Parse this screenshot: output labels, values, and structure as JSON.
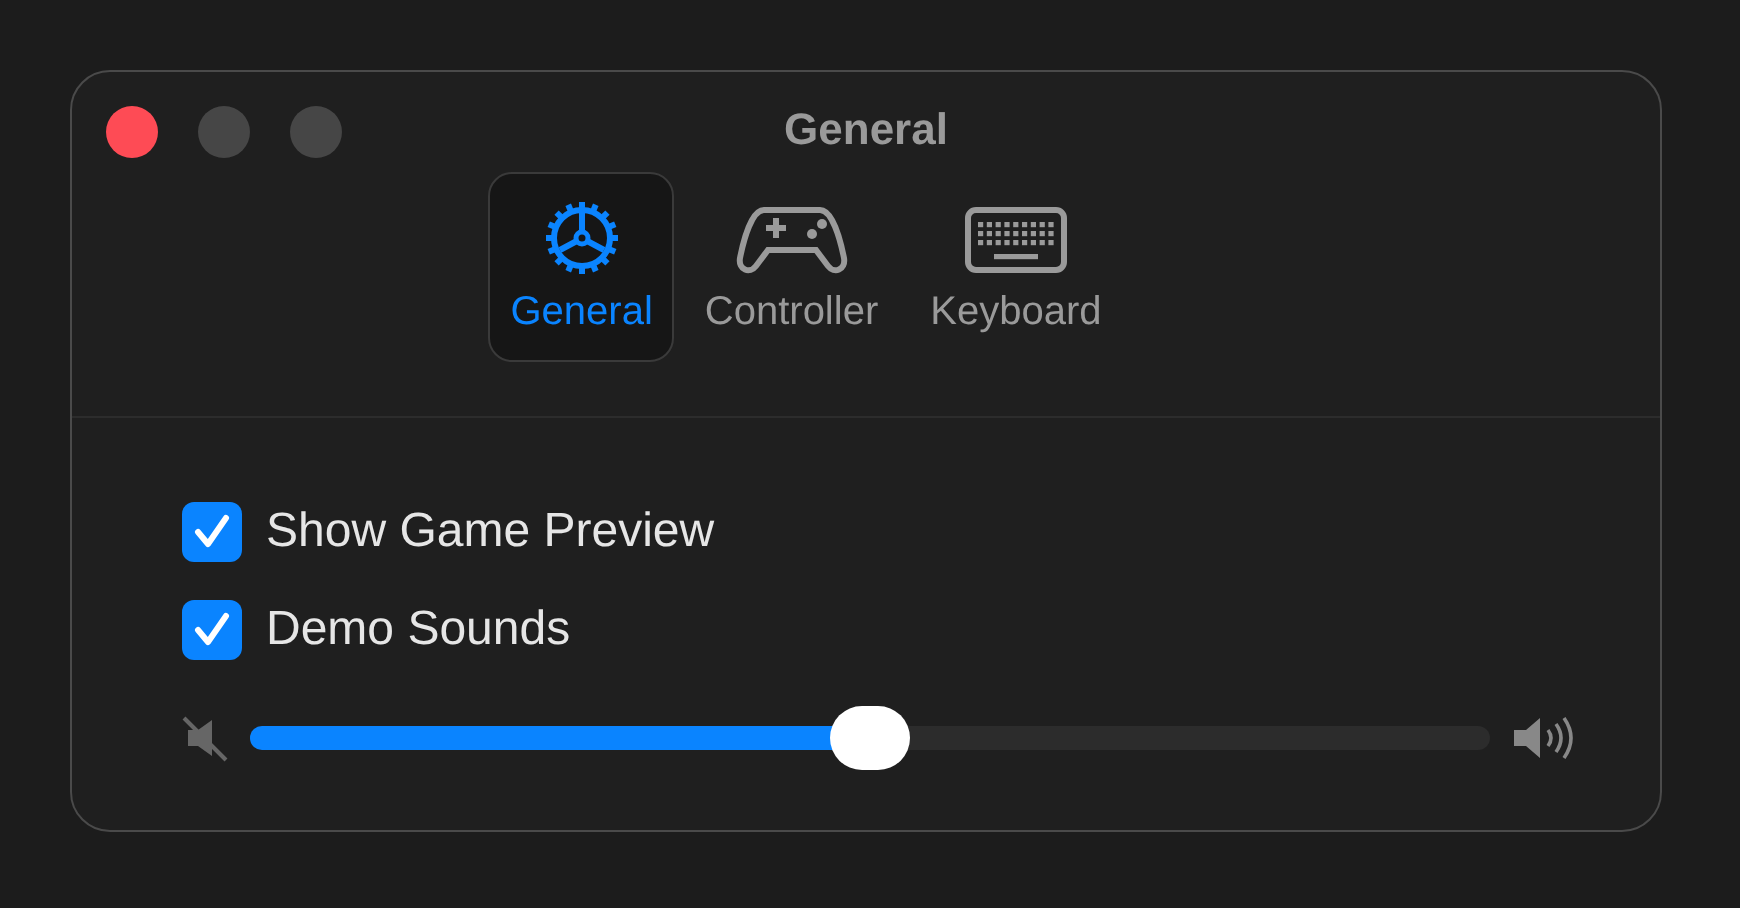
{
  "window": {
    "title": "General"
  },
  "tabs": [
    {
      "label": "General",
      "kind": "gear",
      "selected": true
    },
    {
      "label": "Controller",
      "kind": "gamepad",
      "selected": false
    },
    {
      "label": "Keyboard",
      "kind": "keyboard",
      "selected": false
    }
  ],
  "options": [
    {
      "label": "Show Game Preview",
      "checked": true
    },
    {
      "label": "Demo Sounds",
      "checked": true
    }
  ],
  "volume": {
    "level": 0.5
  }
}
